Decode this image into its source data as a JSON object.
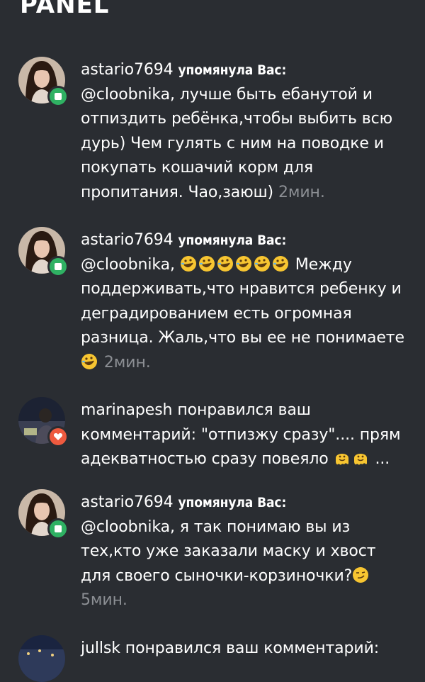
{
  "header": {
    "title": "PANEL"
  },
  "notifications": [
    {
      "user": "astario7694",
      "action": "упомянула Вас:",
      "text_line": "@cloobnika, лучше быть ебанутой и отпиздить ребёнка,чтобы выбить всю дурь) Чем гулять с ним на поводке и покупать кошачий корм для пропитания.  Чао,заюш)",
      "time": "2мин.",
      "badge": "comment-icon"
    },
    {
      "user": "astario7694",
      "action": "упомянула Вас:",
      "prefix": "@cloobnika,",
      "text_after": "Между поддерживать,что нравится ребенку и деградированием есть огромная разница.  Жаль,что вы ее не понимаете",
      "time": "2мин.",
      "badge": "comment-icon"
    },
    {
      "user": "marinapesh",
      "action": "понравился ваш комментарий: \"отпизжу сразу\".... прям адекватностью сразу повеяло",
      "ellipsis": "...",
      "badge": "heart-icon"
    },
    {
      "user": "astario7694",
      "action": "упомянула Вас:",
      "text_line": "@cloobnika, я так понимаю вы из тех,кто уже заказали маску и хвост для своего сыночки-корзиночки?",
      "time": "5мин.",
      "badge": "comment-icon"
    },
    {
      "user": "jullsk",
      "action": "понравился ваш комментарий:"
    }
  ],
  "colors": {
    "background": "#2a2d32",
    "text": "#ffffff",
    "timestamp": "#8c8f94",
    "comment_badge": "#2fb163",
    "like_badge": "#ee5a3f"
  }
}
